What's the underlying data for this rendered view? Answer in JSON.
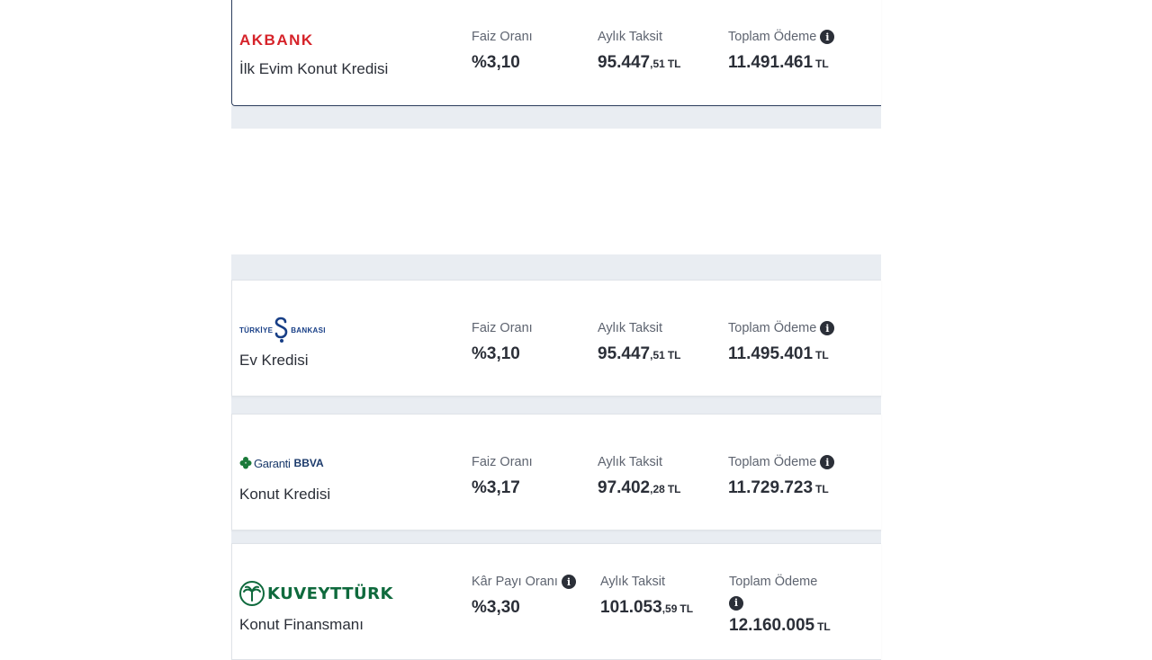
{
  "colors": {
    "akbank": "#d6232a",
    "isbank": "#173e86",
    "garanti": "#1b3a6b",
    "garanti_green": "#1b7a3a",
    "kuveyt": "#0f6a3d",
    "info_icon": "#2b2f38"
  },
  "offers": [
    {
      "bank": "AKBANK",
      "product": "İlk Evim Konut Kredisi",
      "rate_label": "Faiz Oranı",
      "rate": "%3,10",
      "installment_label": "Aylık Taksit",
      "installment_int": "95.447",
      "installment_dec": ",51",
      "installment_cur": "TL",
      "total_label": "Toplam Ödeme",
      "total": "11.491.461",
      "total_cur": "TL"
    },
    {
      "bank_line1": "TÜRKİYE",
      "bank_line2": "BANKASI",
      "product": "Ev Kredisi",
      "rate_label": "Faiz Oranı",
      "rate": "%3,10",
      "installment_label": "Aylık Taksit",
      "installment_int": "95.447",
      "installment_dec": ",51",
      "installment_cur": "TL",
      "total_label": "Toplam Ödeme",
      "total": "11.495.401",
      "total_cur": "TL"
    },
    {
      "bank_name": "Garanti",
      "bank_suffix": "BBVA",
      "product": "Konut Kredisi",
      "rate_label": "Faiz Oranı",
      "rate": "%3,17",
      "installment_label": "Aylık Taksit",
      "installment_int": "97.402",
      "installment_dec": ",28",
      "installment_cur": "TL",
      "total_label": "Toplam Ödeme",
      "total": "11.729.723",
      "total_cur": "TL"
    },
    {
      "bank": "KUVEYTTÜRK",
      "product": "Konut Finansmanı",
      "rate_label": "Kâr Payı Oranı",
      "rate": "%3,30",
      "installment_label": "Aylık Taksit",
      "installment_int": "101.053",
      "installment_dec": ",59",
      "installment_cur": "TL",
      "total_label": "Toplam Ödeme",
      "total": "12.160.005",
      "total_cur": "TL"
    }
  ]
}
